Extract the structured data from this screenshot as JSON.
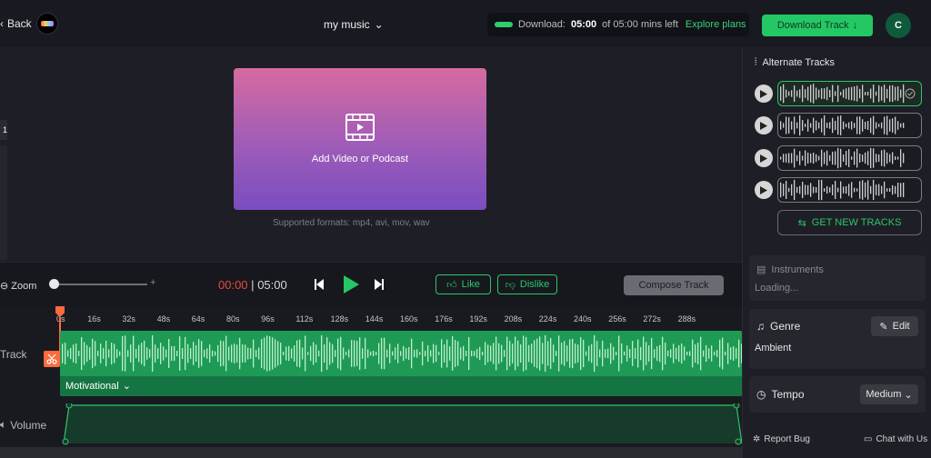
{
  "topbar": {
    "back_label": "Back",
    "title": "my music",
    "download_prefix": "Download:",
    "download_time": "05:00",
    "download_suffix": "of 05:00 mins left",
    "explore_label": "Explore plans",
    "download_button": "Download Track",
    "avatar_initial": "C"
  },
  "preview": {
    "dropzone_label": "Add Video or Podcast",
    "formats_text": "Supported formats: mp4, avi, mov, wav",
    "left_tab_label": "1"
  },
  "controls": {
    "zoom_label": "Zoom",
    "zoom_plus": "+",
    "time_current": "00:00",
    "time_separator": "|",
    "time_total": "05:00",
    "like_label": "Like",
    "dislike_label": "Dislike",
    "compose_label": "Compose Track"
  },
  "timeline": {
    "ticks": [
      "0s",
      "16s",
      "32s",
      "48s",
      "64s",
      "80s",
      "96s",
      "112s",
      "128s",
      "144s",
      "160s",
      "176s",
      "192s",
      "208s",
      "224s",
      "240s",
      "256s",
      "272s",
      "288s"
    ],
    "track_label": "Track",
    "mood_label": "Motivational",
    "volume_label": "Volume"
  },
  "right_panel": {
    "alternate_heading": "Alternate Tracks",
    "get_new_label": "GET NEW TRACKS",
    "instruments_heading": "Instruments",
    "instruments_loading": "Loading...",
    "genre_heading": "Genre",
    "genre_edit": "Edit",
    "genre_value": "Ambient",
    "tempo_heading": "Tempo",
    "tempo_value": "Medium",
    "report_bug": "Report Bug",
    "chat_label": "Chat with Us"
  },
  "colors": {
    "accent_green": "#23c865",
    "playhead_orange": "#ff6a3d",
    "time_red": "#e5493d"
  }
}
